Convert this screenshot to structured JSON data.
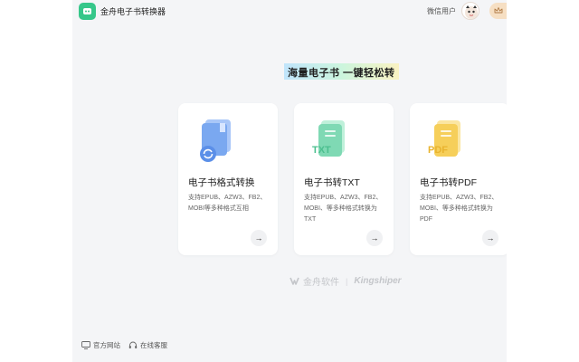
{
  "app": {
    "title": "金舟电子书转换器",
    "username": "微信用户"
  },
  "slogan": "海量电子书  一键轻松转",
  "cards": [
    {
      "title": "电子书格式转换",
      "desc": "支持EPUB、AZW3、FB2、MOBI等多种格式互相",
      "icon": "book-convert-icon",
      "color": "#7aa8f0"
    },
    {
      "title": "电子书转TXT",
      "desc": "支持EPUB、AZW3、FB2、MOBI、等多种格式转换为TXT",
      "icon": "txt-file-icon",
      "color": "#7fd9b4",
      "badge": "TXT"
    },
    {
      "title": "电子书转PDF",
      "desc": "支持EPUB、AZW3、FB2、MOBI、等多种格式转换为PDF",
      "icon": "pdf-file-icon",
      "color": "#f6cf5a",
      "badge": "PDF"
    }
  ],
  "arrow": "→",
  "brand": {
    "cn": "金舟软件",
    "sep": "|",
    "en": "Kingshiper"
  },
  "footer": {
    "website": "官方网站",
    "support": "在线客服"
  },
  "colors": {
    "accent": "#36c78a",
    "background": "#f4f5f7",
    "card": "#ffffff"
  }
}
